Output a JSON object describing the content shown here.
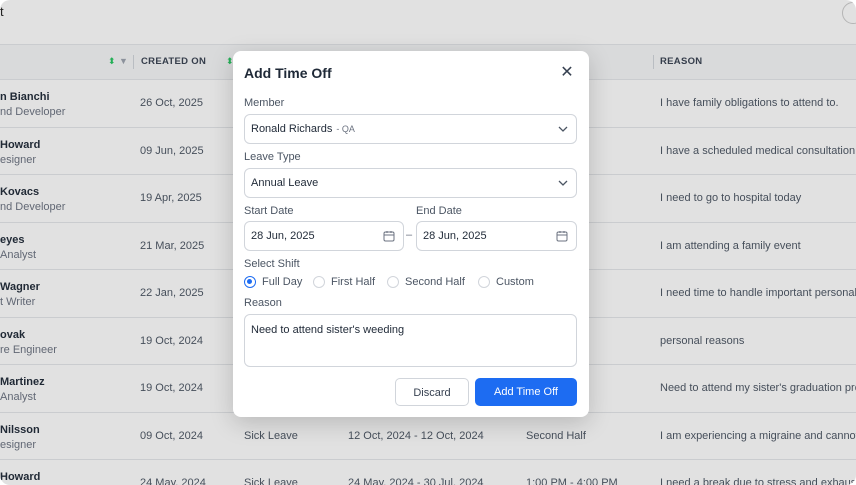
{
  "header": {
    "title_fragment": "t"
  },
  "table": {
    "headers": {
      "created_on": "CREATED ON",
      "reason": "REASON"
    },
    "rows": [
      {
        "name": "n Bianchi",
        "role": "nd Developer",
        "created": "26 Oct, 2025",
        "leave_type": "",
        "dates": "",
        "shift": "",
        "reason": "I have family obligations to attend to."
      },
      {
        "name": "Howard",
        "role": "esigner",
        "created": "09 Jun, 2025",
        "leave_type": "",
        "dates": "",
        "shift": "",
        "reason": "I have a scheduled medical consultation."
      },
      {
        "name": "Kovacs",
        "role": "nd Developer",
        "created": "19 Apr, 2025",
        "leave_type": "",
        "dates": "",
        "shift": "",
        "reason": "I need to go to hospital today"
      },
      {
        "name": "eyes",
        "role": "Analyst",
        "created": "21 Mar, 2025",
        "leave_type": "",
        "dates": "",
        "shift": "",
        "reason": "I am attending a family event"
      },
      {
        "name": "Wagner",
        "role": "t Writer",
        "created": "22 Jan, 2025",
        "leave_type": "",
        "dates": "",
        "shift": "",
        "reason": "I need time to handle important personal m"
      },
      {
        "name": "ovak",
        "role": "re Engineer",
        "created": "19 Oct, 2024",
        "leave_type": "",
        "dates": "",
        "shift": "",
        "reason": "personal reasons"
      },
      {
        "name": "Martinez",
        "role": "Analyst",
        "created": "19 Oct, 2024",
        "leave_type": "",
        "dates": "",
        "shift": "",
        "reason": "Need to attend my sister's graduation pro"
      },
      {
        "name": "Nilsson",
        "role": "esigner",
        "created": "09 Oct, 2024",
        "leave_type": "Sick Leave",
        "dates": "12 Oct, 2024  -  12 Oct, 2024",
        "shift": "Second Half",
        "reason": "I am experiencing a migraine and cannot w"
      },
      {
        "name": "Howard",
        "role": "",
        "created": "24 May, 2024",
        "leave_type": "Sick Leave",
        "dates": "24 May, 2024  -  30 Jul, 2024",
        "shift": "1:00 PM - 4:00 PM",
        "reason": "I need a break due to stress and exhausti"
      }
    ]
  },
  "modal": {
    "title": "Add Time Off",
    "member_label": "Member",
    "member_value": "Ronald Richards",
    "member_sub": "- QA",
    "leave_type_label": "Leave Type",
    "leave_type_value": "Annual Leave",
    "start_label": "Start Date",
    "start_value": "28 Jun, 2025",
    "end_label": "End Date",
    "end_value": "28 Jun, 2025",
    "date_sep": "–",
    "shift_label": "Select Shift",
    "shifts": [
      "Full Day",
      "First Half",
      "Second Half",
      "Custom"
    ],
    "selected_shift": "Full Day",
    "reason_label": "Reason",
    "reason_value": "Need to attend sister's weeding",
    "discard": "Discard",
    "submit": "Add Time Off",
    "close_glyph": "✕"
  },
  "colors": {
    "accent": "#1d6cf2",
    "sort": "#22c55e"
  }
}
